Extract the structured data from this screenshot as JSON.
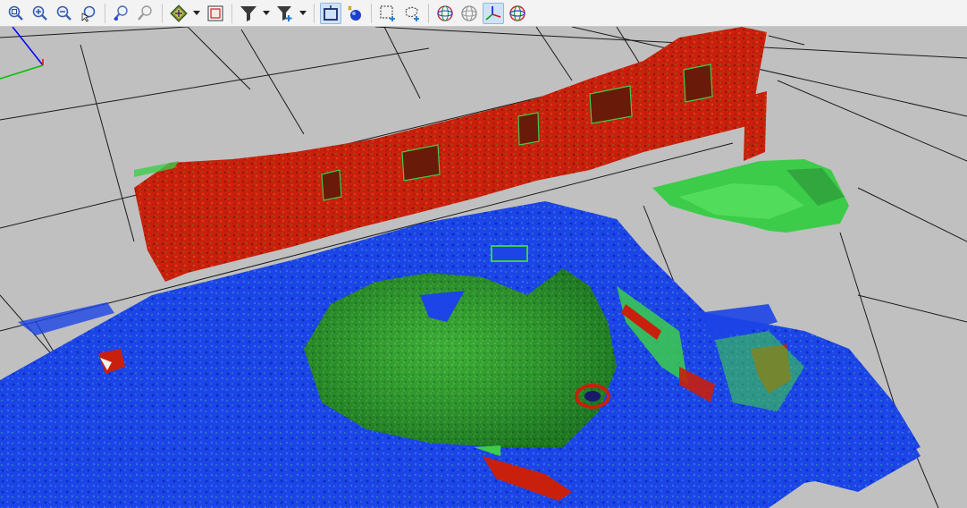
{
  "toolbar": {
    "buttons": [
      {
        "name": "zoom-fit-icon"
      },
      {
        "name": "zoom-in-icon"
      },
      {
        "name": "zoom-out-icon"
      },
      {
        "name": "zoom-selection-icon"
      },
      {
        "name": "pick-point-icon"
      },
      {
        "name": "pick-region-icon"
      },
      {
        "name": "navigation-mode-icon"
      },
      {
        "name": "frame-view-icon"
      },
      {
        "name": "filter-icon"
      },
      {
        "name": "filter-add-icon"
      },
      {
        "name": "select-rectangle-icon"
      },
      {
        "name": "select-point-icon"
      },
      {
        "name": "box-select-icon"
      },
      {
        "name": "lasso-select-icon"
      },
      {
        "name": "sphere-view-icon"
      },
      {
        "name": "sphere-grid-icon"
      },
      {
        "name": "axes-icon"
      },
      {
        "name": "sphere-color-icon"
      }
    ],
    "active": [
      "select-rectangle-icon",
      "axes-icon"
    ]
  },
  "viewport": {
    "background": "#c0c0c0",
    "grid_color": "#1a1a1a",
    "colors": {
      "wall": "#c8200c",
      "ground": "#1c44e6",
      "mound": "#2fa02f",
      "vegetation": "#3ccc4a",
      "axis_x": "#00c000",
      "axis_y": "#0000ff",
      "axis_z": "#ff0000"
    }
  }
}
